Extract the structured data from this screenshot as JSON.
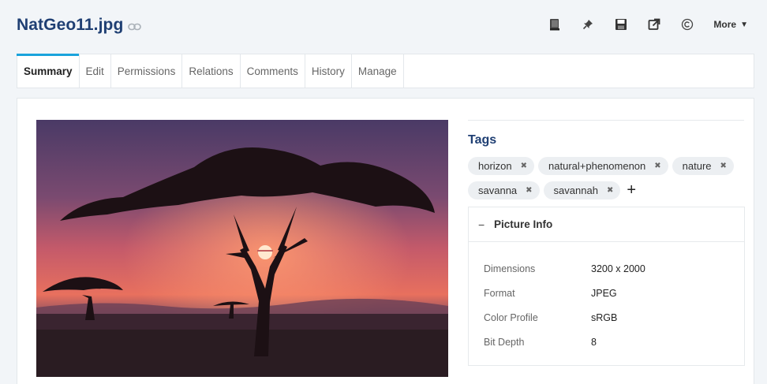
{
  "header": {
    "title": "NatGeo11.jpg",
    "more_label": "More",
    "toolbar_icons": [
      "book-icon",
      "pin-icon",
      "save-icon",
      "external-link-icon",
      "copyright-icon"
    ]
  },
  "tabs": [
    {
      "label": "Summary",
      "active": true
    },
    {
      "label": "Edit"
    },
    {
      "label": "Permissions"
    },
    {
      "label": "Relations"
    },
    {
      "label": "Comments"
    },
    {
      "label": "History"
    },
    {
      "label": "Manage"
    }
  ],
  "tags_section": {
    "title": "Tags",
    "tags": [
      "horizon",
      "natural+phenomenon",
      "nature",
      "savanna",
      "savannah"
    ],
    "remove_glyph": "✖",
    "add_glyph": "+"
  },
  "picture_info": {
    "title": "Picture Info",
    "collapse_glyph": "−",
    "rows": [
      {
        "key": "Dimensions",
        "value": "3200 x 2000"
      },
      {
        "key": "Format",
        "value": "JPEG"
      },
      {
        "key": "Color Profile",
        "value": "sRGB"
      },
      {
        "key": "Bit Depth",
        "value": "8"
      }
    ]
  },
  "colors": {
    "accent": "#1aa3dc",
    "title": "#1f3f73",
    "background": "#f2f5f8"
  }
}
